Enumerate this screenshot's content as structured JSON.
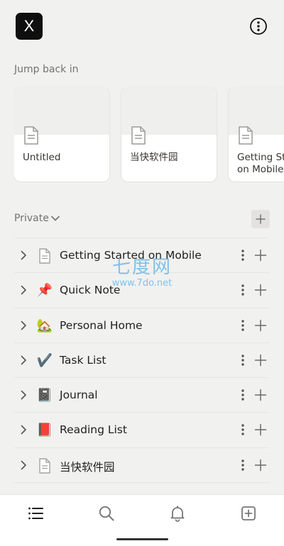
{
  "workspace": {
    "initial": "X"
  },
  "icons": {
    "more": "more-vertical-icon",
    "page": "page-icon",
    "chevron_right": "chevron-right-icon",
    "chevron_down": "chevron-down-icon",
    "plus": "plus-icon",
    "dots": "dots-vertical-icon"
  },
  "jump_back": {
    "title": "Jump back in",
    "cards": [
      {
        "title": "Untitled",
        "icon": "page-icon"
      },
      {
        "title": "当快软件园",
        "icon": "page-icon"
      },
      {
        "title": "Getting Started on Mobile",
        "icon": "page-icon"
      }
    ]
  },
  "private": {
    "label": "Private",
    "pages": [
      {
        "title": "Getting Started on Mobile",
        "emoji": "",
        "icon": "page-icon"
      },
      {
        "title": "Quick Note",
        "emoji": "📌",
        "icon": "pushpin-icon"
      },
      {
        "title": "Personal Home",
        "emoji": "🏡",
        "icon": "house-icon"
      },
      {
        "title": "Task List",
        "emoji": "✔️",
        "icon": "check-mark-icon"
      },
      {
        "title": "Journal",
        "emoji": "📓",
        "icon": "notebook-icon"
      },
      {
        "title": "Reading List",
        "emoji": "📕",
        "icon": "red-book-icon"
      },
      {
        "title": "当快软件园",
        "emoji": "",
        "icon": "page-icon"
      }
    ]
  },
  "watermark": {
    "text": "七度网",
    "url": "www.7do.net"
  },
  "bottom_nav": [
    {
      "name": "home",
      "icon": "list-icon"
    },
    {
      "name": "search",
      "icon": "search-icon"
    },
    {
      "name": "updates",
      "icon": "bell-icon"
    },
    {
      "name": "new-page",
      "icon": "new-page-icon"
    }
  ],
  "colors": {
    "background": "#f1f1ef",
    "text": "#37352f",
    "muted": "#73726e",
    "watermark": "#5db1e8"
  }
}
